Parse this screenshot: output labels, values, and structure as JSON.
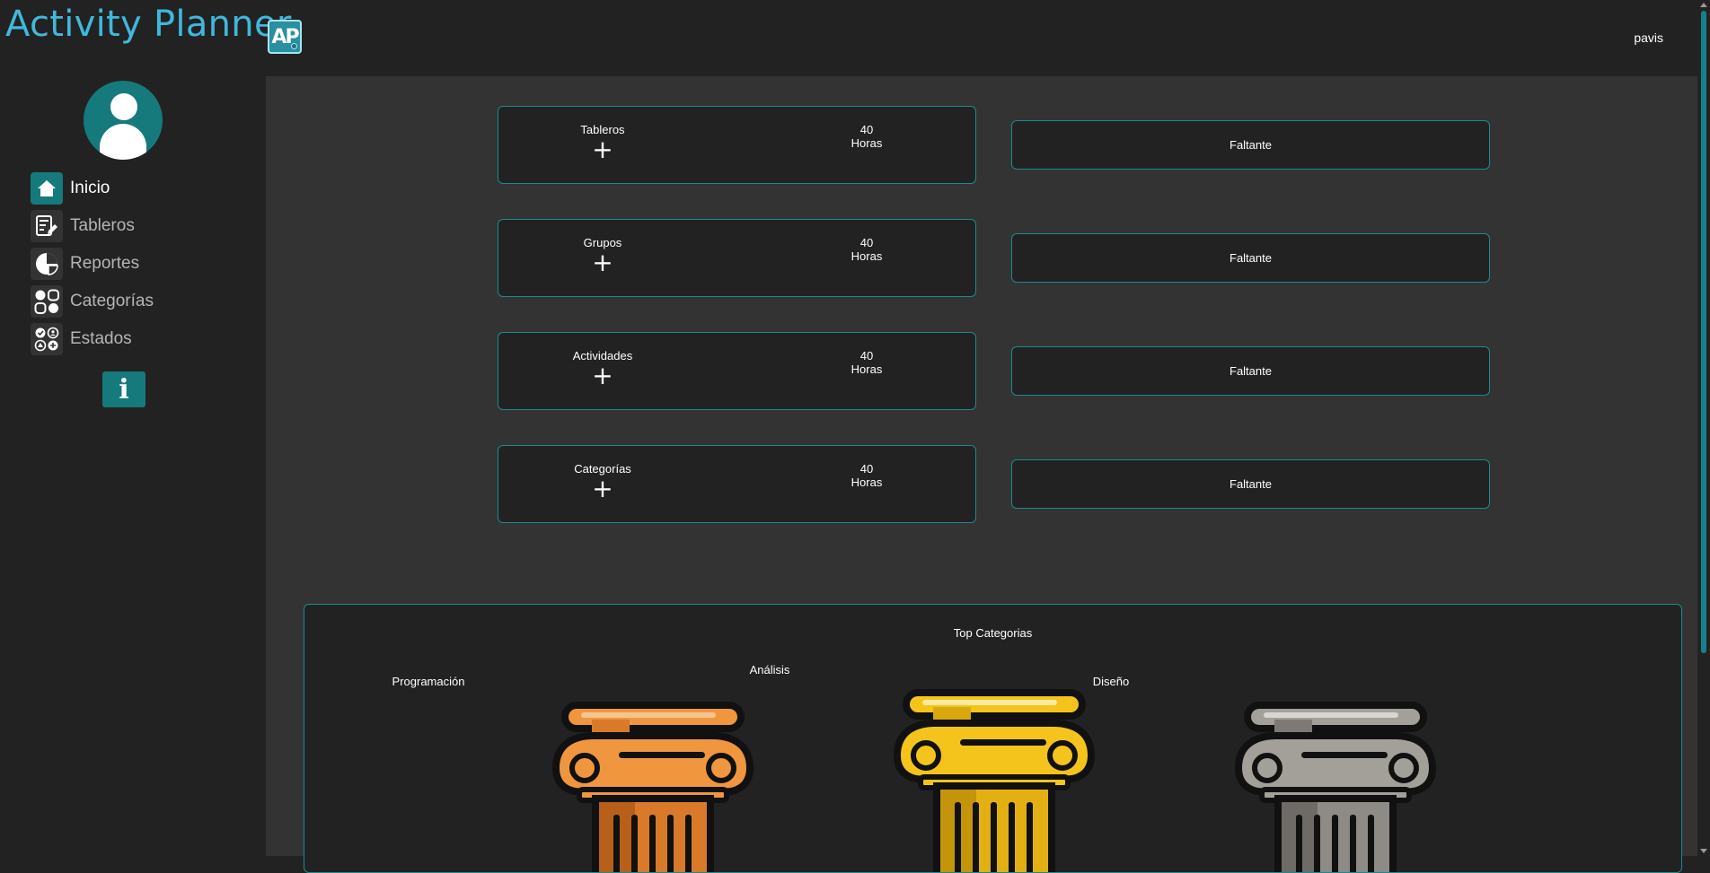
{
  "app": {
    "title": "Activity Planner",
    "logo_text": "AP"
  },
  "user": {
    "name": "pavis"
  },
  "sidebar": {
    "items": [
      {
        "label": "Inicio",
        "icon": "home-icon",
        "active": true
      },
      {
        "label": "Tableros",
        "icon": "board-edit-icon",
        "active": false
      },
      {
        "label": "Reportes",
        "icon": "pie-chart-icon",
        "active": false
      },
      {
        "label": "Categorías",
        "icon": "categories-icon",
        "active": false
      },
      {
        "label": "Estados",
        "icon": "states-icon",
        "active": false
      }
    ],
    "info_label": "i"
  },
  "summary": {
    "cards": [
      {
        "title": "Tableros",
        "plus": "+",
        "hours_value": "40",
        "hours_unit": "Horas",
        "missing": "Faltante"
      },
      {
        "title": "Grupos",
        "plus": "+",
        "hours_value": "40",
        "hours_unit": "Horas",
        "missing": "Faltante"
      },
      {
        "title": "Actividades",
        "plus": "+",
        "hours_value": "40",
        "hours_unit": "Horas",
        "missing": "Faltante"
      },
      {
        "title": "Categorías",
        "plus": "+",
        "hours_value": "40",
        "hours_unit": "Horas",
        "missing": "Faltante"
      }
    ]
  },
  "top_categories": {
    "title": "Top Categorias",
    "items": [
      {
        "name": "Programación",
        "medal": "bronze",
        "color": "#f0963f"
      },
      {
        "name": "Análisis",
        "medal": "gold",
        "color": "#f4c41c"
      },
      {
        "name": "Diseño",
        "medal": "silver",
        "color": "#a3a09a"
      }
    ]
  },
  "colors": {
    "accent": "#167a7c",
    "title": "#3fb8dd",
    "border": "#1d8a90"
  }
}
